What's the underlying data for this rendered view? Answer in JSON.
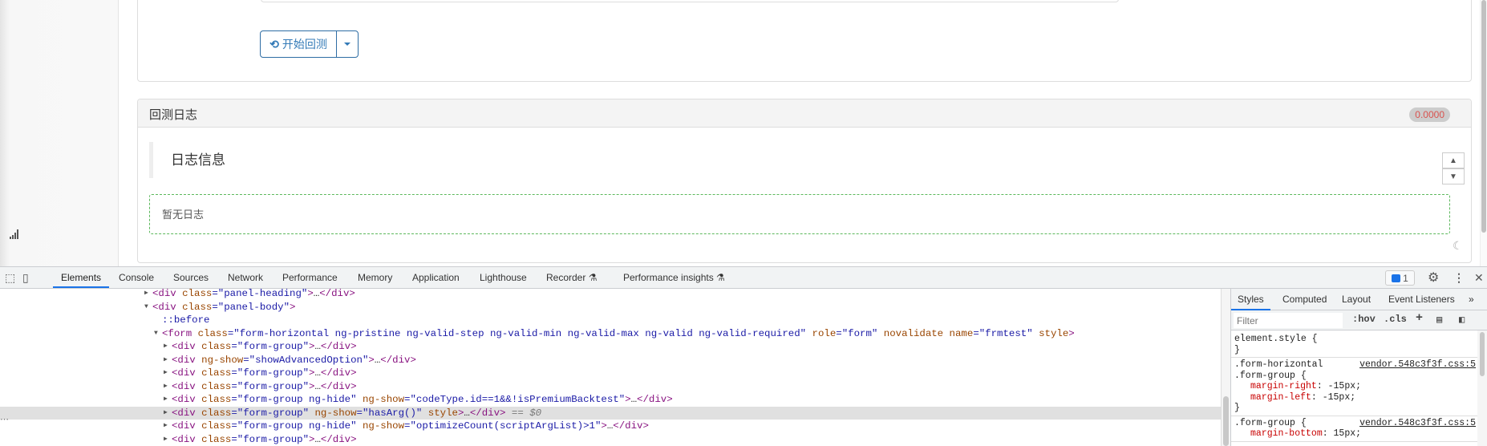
{
  "page": {
    "start_backtest_label": "开始回测",
    "log_panel": {
      "title": "回测日志",
      "badge": "0.0000",
      "badge_color": "#d9534f",
      "section_title": "日志信息",
      "empty_text": "暂无日志"
    },
    "icons": {
      "backtest": "history-icon",
      "dropdown": "caret-down-icon",
      "scroll_up": "chevron-up-icon",
      "scroll_down": "chevron-down-icon",
      "theme": "moon-icon",
      "signal": "signal-icon"
    }
  },
  "devtools": {
    "tabs": [
      {
        "label": "Elements",
        "active": true
      },
      {
        "label": "Console"
      },
      {
        "label": "Sources"
      },
      {
        "label": "Network"
      },
      {
        "label": "Performance"
      },
      {
        "label": "Memory"
      },
      {
        "label": "Application"
      },
      {
        "label": "Lighthouse"
      },
      {
        "label": "Recorder",
        "experimental": true
      },
      {
        "label": "Performance insights",
        "experimental": true
      }
    ],
    "issues_count": "1",
    "accent": "#1a73e8",
    "dom_lines": [
      {
        "level": 1,
        "state": "collapsed",
        "tokens": [
          [
            "tag",
            "<div"
          ],
          [
            "attr",
            " class"
          ],
          [
            "val",
            "=\"panel-heading\""
          ],
          [
            "tag",
            ">"
          ],
          [
            "txt",
            "…"
          ],
          [
            "tag",
            "</div>"
          ]
        ]
      },
      {
        "level": 1,
        "state": "expanded",
        "tokens": [
          [
            "tag",
            "<div"
          ],
          [
            "attr",
            " class"
          ],
          [
            "val",
            "=\"panel-body\""
          ],
          [
            "tag",
            ">"
          ]
        ]
      },
      {
        "level": 2,
        "state": "none",
        "tokens": [
          [
            "pseudo",
            "::before"
          ]
        ]
      },
      {
        "level": 2,
        "state": "expanded",
        "tokens": [
          [
            "tag",
            "<form"
          ],
          [
            "attr",
            " class"
          ],
          [
            "val",
            "=\"form-horizontal ng-pristine ng-valid-step ng-valid-min ng-valid-max ng-valid ng-valid-required\""
          ],
          [
            "attr",
            " role"
          ],
          [
            "val",
            "=\"form\""
          ],
          [
            "attr",
            " novalidate name"
          ],
          [
            "val",
            "=\"frmtest\""
          ],
          [
            "attr",
            " style"
          ],
          [
            "tag",
            ">"
          ]
        ]
      },
      {
        "level": 3,
        "state": "collapsed",
        "tokens": [
          [
            "tag",
            "<div"
          ],
          [
            "attr",
            " class"
          ],
          [
            "val",
            "=\"form-group\""
          ],
          [
            "tag",
            ">"
          ],
          [
            "txt",
            "…"
          ],
          [
            "tag",
            "</div>"
          ]
        ]
      },
      {
        "level": 3,
        "state": "collapsed",
        "tokens": [
          [
            "tag",
            "<div"
          ],
          [
            "attr",
            " ng-show"
          ],
          [
            "val",
            "=\"showAdvancedOption\""
          ],
          [
            "tag",
            ">"
          ],
          [
            "txt",
            "…"
          ],
          [
            "tag",
            "</div>"
          ]
        ]
      },
      {
        "level": 3,
        "state": "collapsed",
        "tokens": [
          [
            "tag",
            "<div"
          ],
          [
            "attr",
            " class"
          ],
          [
            "val",
            "=\"form-group\""
          ],
          [
            "tag",
            ">"
          ],
          [
            "txt",
            "…"
          ],
          [
            "tag",
            "</div>"
          ]
        ]
      },
      {
        "level": 3,
        "state": "collapsed",
        "tokens": [
          [
            "tag",
            "<div"
          ],
          [
            "attr",
            " class"
          ],
          [
            "val",
            "=\"form-group\""
          ],
          [
            "tag",
            ">"
          ],
          [
            "txt",
            "…"
          ],
          [
            "tag",
            "</div>"
          ]
        ]
      },
      {
        "level": 3,
        "state": "collapsed",
        "tokens": [
          [
            "tag",
            "<div"
          ],
          [
            "attr",
            " class"
          ],
          [
            "val",
            "=\"form-group ng-hide\""
          ],
          [
            "attr",
            " ng-show"
          ],
          [
            "val",
            "=\"codeType.id==1&&!isPremiumBacktest\""
          ],
          [
            "tag",
            ">"
          ],
          [
            "txt",
            "…"
          ],
          [
            "tag",
            "</div>"
          ]
        ]
      },
      {
        "level": 3,
        "state": "collapsed",
        "selected": true,
        "tokens": [
          [
            "tag",
            "<div"
          ],
          [
            "attr",
            " class"
          ],
          [
            "val",
            "=\"form-group\""
          ],
          [
            "attr",
            " ng-show"
          ],
          [
            "val",
            "=\"hasArg()\""
          ],
          [
            "attr",
            " style"
          ],
          [
            "tag",
            ">"
          ],
          [
            "txt",
            "…"
          ],
          [
            "tag",
            "</div>"
          ],
          [
            "ref",
            " == $0"
          ]
        ]
      },
      {
        "level": 3,
        "state": "collapsed",
        "tokens": [
          [
            "tag",
            "<div"
          ],
          [
            "attr",
            " class"
          ],
          [
            "val",
            "=\"form-group ng-hide\""
          ],
          [
            "attr",
            " ng-show"
          ],
          [
            "val",
            "=\"optimizeCount(scriptArgList)>1\""
          ],
          [
            "tag",
            ">"
          ],
          [
            "txt",
            "…"
          ],
          [
            "tag",
            "</div>"
          ]
        ]
      },
      {
        "level": 3,
        "state": "collapsed",
        "tokens": [
          [
            "tag",
            "<div"
          ],
          [
            "attr",
            " class"
          ],
          [
            "val",
            "=\"form-group\""
          ],
          [
            "tag",
            ">"
          ],
          [
            "txt",
            "…"
          ],
          [
            "tag",
            "</div>"
          ]
        ]
      }
    ],
    "styles": {
      "tabs": [
        "Styles",
        "Computed",
        "Layout",
        "Event Listeners",
        "»"
      ],
      "filter_placeholder": "Filter",
      "hov": ":hov",
      "cls": ".cls",
      "plus": "+",
      "rules": [
        {
          "selector": [
            "element.style {"
          ],
          "source": "",
          "props": [],
          "close": "}"
        },
        {
          "selector": [
            ".form-horizontal",
            ".form-group {"
          ],
          "source": "vendor.548c3f3f.css:5",
          "props": [
            [
              "margin-right",
              "-15px"
            ],
            [
              "margin-left",
              "-15px"
            ]
          ],
          "close": "}"
        },
        {
          "selector": [
            ".form-group {"
          ],
          "source": "vendor.548c3f3f.css:5",
          "props": [
            [
              "margin-bottom",
              "15px"
            ]
          ],
          "close": ""
        }
      ]
    }
  }
}
